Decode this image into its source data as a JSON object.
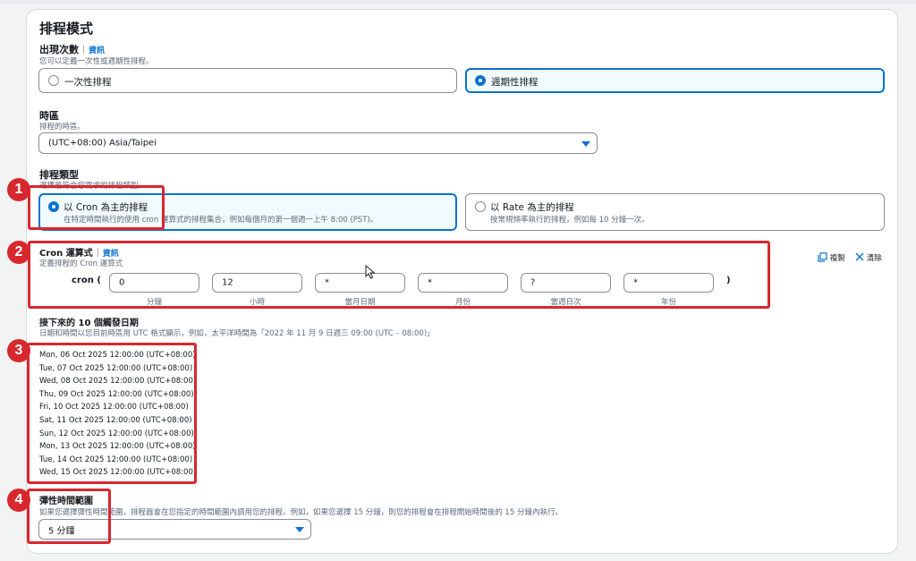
{
  "section": {
    "title": "排程模式"
  },
  "occurrence": {
    "label": "出現次數",
    "info": "資訊",
    "desc": "您可以定義一次性或週期性排程。",
    "options": [
      {
        "label": "一次性排程",
        "selected": false
      },
      {
        "label": "週期性排程",
        "selected": true
      }
    ]
  },
  "timezone": {
    "label": "時區",
    "desc": "排程的時區。",
    "value": "(UTC+08:00) Asia/Taipei"
  },
  "schedule_type": {
    "label": "排程類型",
    "desc": "選擇最符合您需求的排程類型。",
    "options": [
      {
        "label": "以 Cron 為主的排程",
        "desc": "在特定時間執行的使用 cron 運算式的排程集合，例如每個月的第一個週一上午 8:00 (PST)。",
        "selected": true
      },
      {
        "label": "以 Rate 為主的排程",
        "desc": "按常規頻率執行的排程，例如每 10 分鐘一次。",
        "selected": false
      }
    ]
  },
  "cron": {
    "label": "Cron 運算式",
    "info": "資訊",
    "desc": "定義排程的 Cron 運算式",
    "prefix": "cron (",
    "suffix": ")",
    "fields": [
      {
        "value": "0",
        "caption": "分鐘"
      },
      {
        "value": "12",
        "caption": "小時"
      },
      {
        "value": "*",
        "caption": "當月日期"
      },
      {
        "value": "*",
        "caption": "月份"
      },
      {
        "value": "?",
        "caption": "當週日次"
      },
      {
        "value": "*",
        "caption": "年份"
      }
    ],
    "copy_label": "複製",
    "clear_label": "清除"
  },
  "next_dates": {
    "label": "接下來的 10 個觸發日期",
    "desc": "日期和時間以您目前時區用 UTC 格式顯示，例如，太平洋時間為「2022 年 11 月 9 日週三 09:00 (UTC – 08:00)」",
    "dates": [
      "Mon, 06 Oct 2025 12:00:00 (UTC+08:00)",
      "Tue, 07 Oct 2025 12:00:00 (UTC+08:00)",
      "Wed, 08 Oct 2025 12:00:00 (UTC+08:00)",
      "Thu, 09 Oct 2025 12:00:00 (UTC+08:00)",
      "Fri, 10 Oct 2025 12:00:00 (UTC+08:00)",
      "Sat, 11 Oct 2025 12:00:00 (UTC+08:00)",
      "Sun, 12 Oct 2025 12:00:00 (UTC+08:00)",
      "Mon, 13 Oct 2025 12:00:00 (UTC+08:00)",
      "Tue, 14 Oct 2025 12:00:00 (UTC+08:00)",
      "Wed, 15 Oct 2025 12:00:00 (UTC+08:00)"
    ]
  },
  "flex_window": {
    "label": "彈性時間範圍",
    "desc": "如果您選擇彈性時間範圍，排程器會在您指定的時間範圍內調用您的排程。例如，如果您選擇 15 分鐘，則您的排程會在排程開始時間後的 15 分鐘內執行。",
    "value": "5 分鐘"
  },
  "annotations": [
    "1",
    "2",
    "3",
    "4"
  ],
  "colors": {
    "accent": "#0972d3",
    "annotation": "#d7282f",
    "selected_bg": "#f1faff"
  }
}
